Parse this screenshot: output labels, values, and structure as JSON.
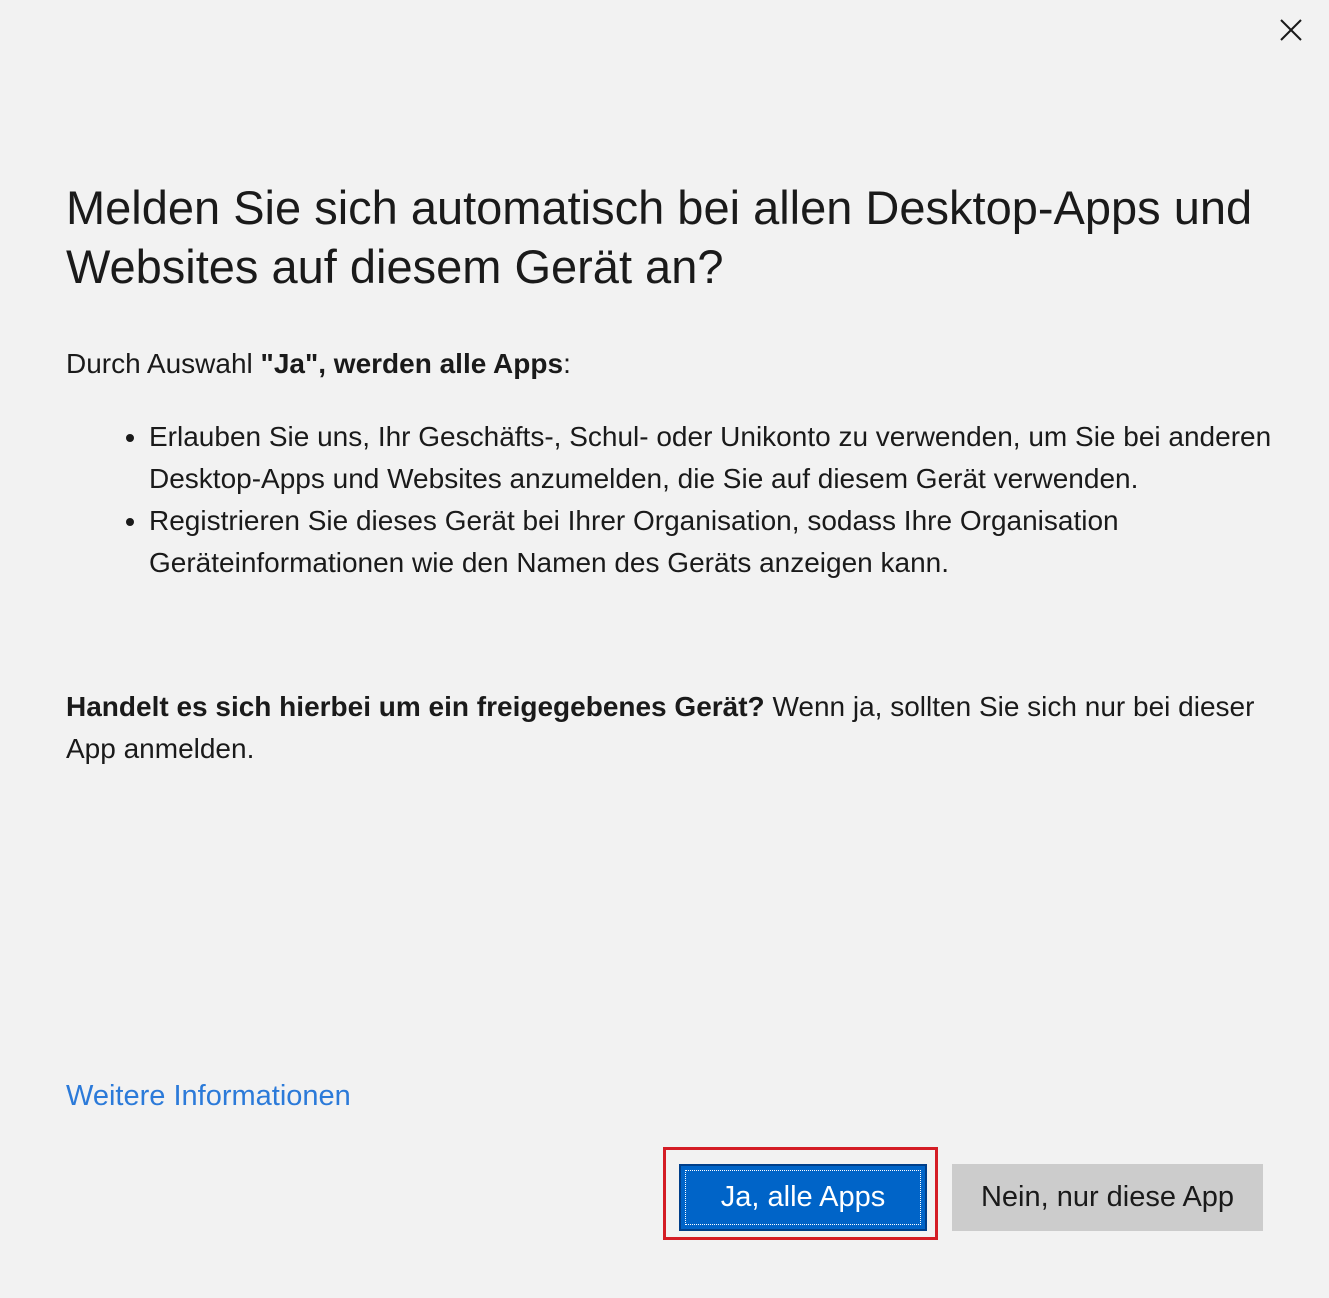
{
  "dialog": {
    "close_icon": "close-icon",
    "heading": "Melden Sie sich automatisch bei allen Desktop-Apps und Websites auf diesem Gerät an?",
    "intro": {
      "prefix": "Durch Auswahl ",
      "bold": "\"Ja\", werden alle Apps",
      "suffix": ":"
    },
    "bullets": [
      "Erlauben Sie uns, Ihr Geschäfts-, Schul- oder Unikonto zu verwenden, um Sie bei anderen Desktop-Apps und Websites anzumelden, die Sie auf diesem Gerät verwenden.",
      "Registrieren Sie dieses Gerät bei Ihrer Organisation, sodass Ihre Organisation Geräteinformationen wie den Namen des Geräts anzeigen kann."
    ],
    "shared_device": {
      "bold": "Handelt es sich hierbei um ein freigegebenes Gerät?",
      "text": " Wenn ja, sollten Sie sich nur bei dieser App anmelden."
    },
    "more_info_link": "Weitere Informationen",
    "buttons": {
      "primary": "Ja, alle Apps",
      "secondary": "Nein, nur diese App"
    }
  },
  "colors": {
    "background": "#f2f2f2",
    "link": "#2b7ad9",
    "primary_button": "#0064c8",
    "secondary_button": "#cccccc",
    "highlight_border": "#d41d25"
  }
}
